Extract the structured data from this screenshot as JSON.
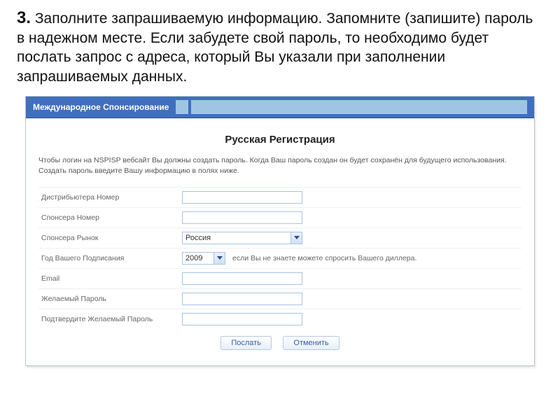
{
  "instructions": {
    "step_num": "3.",
    "text": "Заполните запрашиваемую информацию. Запомните (запишите) пароль в надежном месте. Если забудете свой пароль, то необходимо будет послать запрос с адреса, который Вы указали при заполнении запрашиваемых данных."
  },
  "titlebar": {
    "title": "Международное Спонсирование"
  },
  "form": {
    "heading": "Русская Регистрация",
    "intro_line1": "Чтобы логин на NSPISP вебсайт Вы должны создать пароль. Когда Ваш пароль создан он будет сохранён для будущего использования.",
    "intro_line2": "Создать пароль введите Вашу информацию в полях ниже.",
    "fields": {
      "distributor_label": "Дистрибьютера Номер",
      "sponsor_label": "Спонсера Номер",
      "sponsor_market_label": "Спонсера Рынок",
      "sponsor_market_value": "Россия",
      "year_label": "Год Вашего Подписания",
      "year_value": "2009",
      "year_hint": "если Вы не знаете можете спросить Вашего диллера.",
      "email_label": "Email",
      "password_label": "Желаемый Пароль",
      "confirm_label": "Подтвердите Желаемый Пароль"
    },
    "buttons": {
      "submit": "Послать",
      "cancel": "Отменить"
    }
  }
}
